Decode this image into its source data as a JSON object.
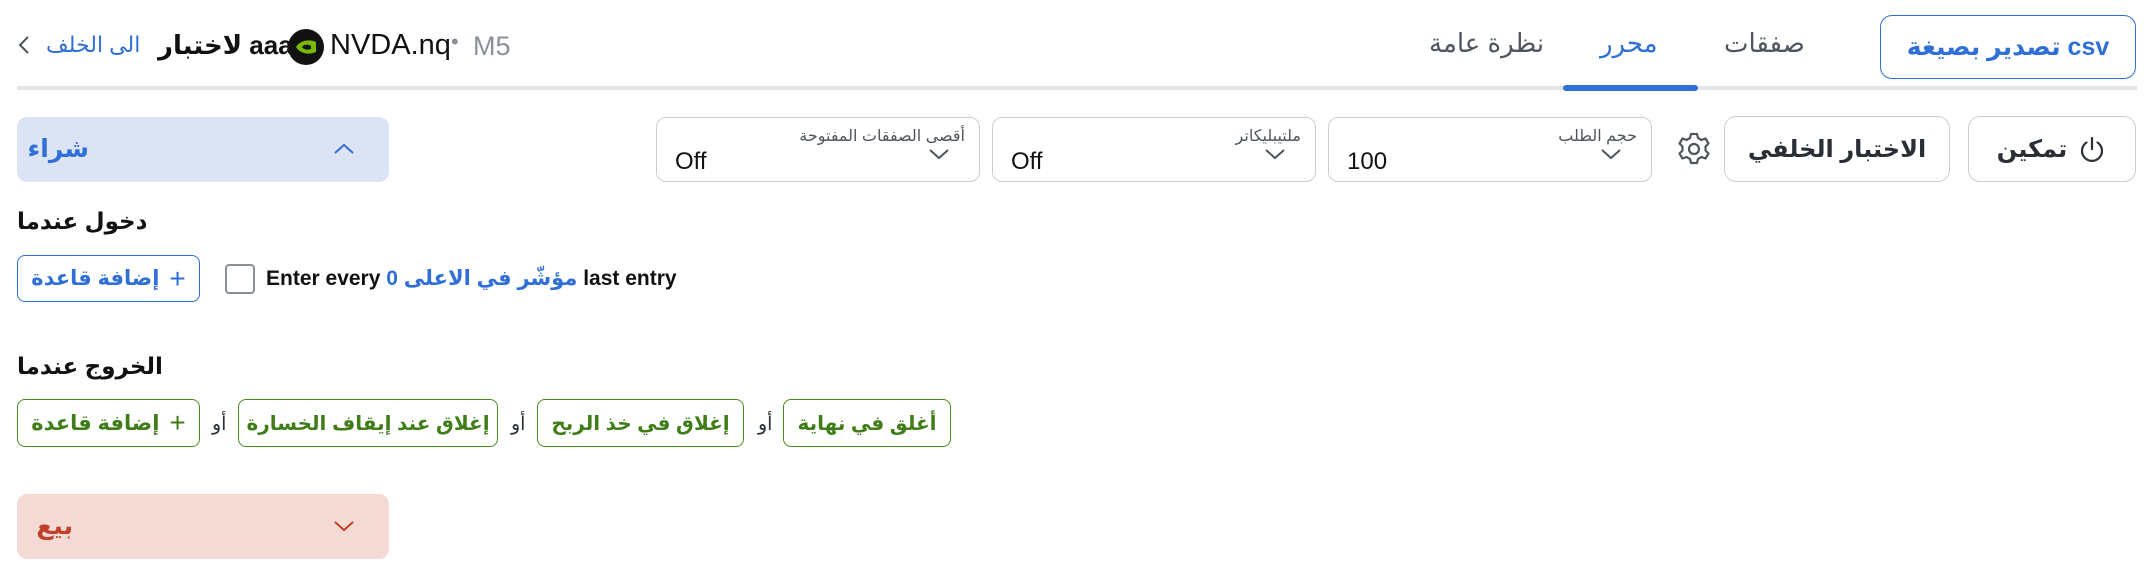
{
  "header": {
    "back_label": "الى الخلف",
    "test_title": "لاختبار aaa",
    "symbol": "NVDA.nq",
    "separator": "•",
    "timeframe": "M5",
    "export_label": "تصدير بصيغة csv",
    "tabs": [
      {
        "label": "صفقات",
        "active": false
      },
      {
        "label": "محرر",
        "active": true
      },
      {
        "label": "نظرة عامة",
        "active": false
      }
    ]
  },
  "toolbar": {
    "enable_label": "تمكين",
    "backtest_label": "الاختبار الخلفي",
    "selects": [
      {
        "label": "حجم الطلب",
        "value": "100"
      },
      {
        "label": "ملتيبليكاتر",
        "value": "Off"
      },
      {
        "label": "أقصى الصفقات المفتوحة",
        "value": "Off"
      }
    ]
  },
  "buy": {
    "title": "شراء",
    "entry_title": "دخول عندما",
    "add_rule_label": "إضافة قاعدة",
    "entry_rule": {
      "prefix": "Enter every",
      "count": "0",
      "indicator": "مؤشّر في الاعلى",
      "suffix": "last entry"
    },
    "exit_title": "الخروج عندما",
    "exit_rules": [
      "أغلق في نهاية",
      "إغلاق في خذ الربح",
      "إغلاق عند إيقاف الخسارة"
    ],
    "or_label": "أو"
  },
  "sell": {
    "title": "بيع"
  },
  "icons": {
    "back": "chevron-left-icon",
    "logo": "nvidia-logo-icon",
    "settings": "gear-icon",
    "power": "power-icon",
    "expand": "chevron-up-icon",
    "collapse": "chevron-down-icon",
    "add": "plus-icon"
  },
  "colors": {
    "accent": "#2f6fd6",
    "buy_panel": "#dbe3f5",
    "sell_panel": "#f5d9d4",
    "sell_text": "#c0412a",
    "exit_green": "#3f7d18",
    "nvidia_green": "#76b900"
  }
}
